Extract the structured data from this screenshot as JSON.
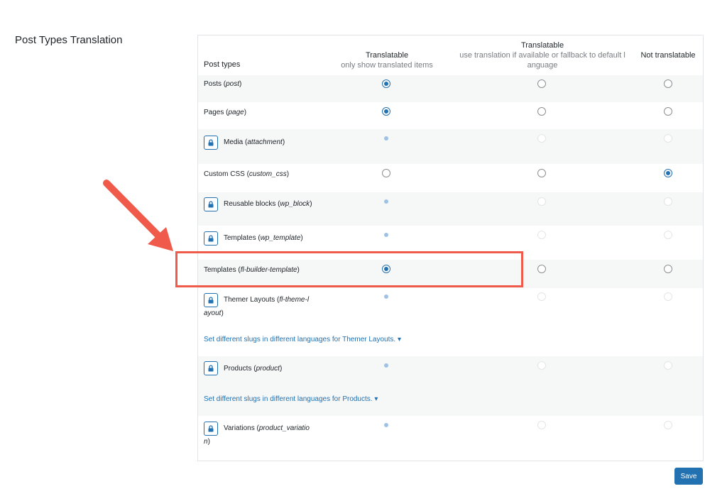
{
  "section_title": "Post Types Translation",
  "header": {
    "post_types": "Post types",
    "col1_title": "Translatable",
    "col1_sub": "only show translated items",
    "col2_title": "Translatable",
    "col2_sub_line1": "use translation if available or fallback to default l",
    "col2_sub_line2": "anguage",
    "col3_title": "Not translatable"
  },
  "rows": [
    {
      "name": "Posts (",
      "slug": "post",
      "close": ")",
      "locked": false,
      "selected": "translatable"
    },
    {
      "name": "Pages (",
      "slug": "page",
      "close": ")",
      "locked": false,
      "selected": "translatable"
    },
    {
      "name": "Media (",
      "slug": "attachment",
      "close": ")",
      "locked": true,
      "selected": "translatable"
    },
    {
      "name": "Custom CSS (",
      "slug": "custom_css",
      "close": ")",
      "locked": false,
      "selected": "not_translatable"
    },
    {
      "name": "Reusable blocks (",
      "slug": "wp_block",
      "close": ")",
      "locked": true,
      "selected": "translatable"
    },
    {
      "name": "Templates (",
      "slug": "wp_template",
      "close": ")",
      "locked": true,
      "selected": "translatable"
    },
    {
      "name": "Templates (",
      "slug": "fl-builder-template",
      "close": ")",
      "locked": false,
      "selected": "translatable"
    },
    {
      "name": "Themer Layouts (",
      "slug_line1": "fl-theme-l",
      "slug_line2": "ayout",
      "close": ")",
      "locked": true,
      "selected": "translatable"
    },
    {
      "name": "Products (",
      "slug": "product",
      "close": ")",
      "locked": true,
      "selected": "translatable"
    },
    {
      "name": "Variations (",
      "slug_line1": "product_variatio",
      "slug_line2": "n",
      "close": ")",
      "locked": true,
      "selected": "translatable"
    }
  ],
  "slug_links": {
    "themer": "Set different slugs in different languages for Themer Layouts.",
    "products": "Set different slugs in different languages for Products.",
    "caret": "▾"
  },
  "save_label": "Save",
  "colors": {
    "accent": "#2271b1",
    "annotation": "#f05a4a"
  },
  "icons": {
    "lock": "lock-icon",
    "arrow": "annotation-arrow-icon"
  }
}
